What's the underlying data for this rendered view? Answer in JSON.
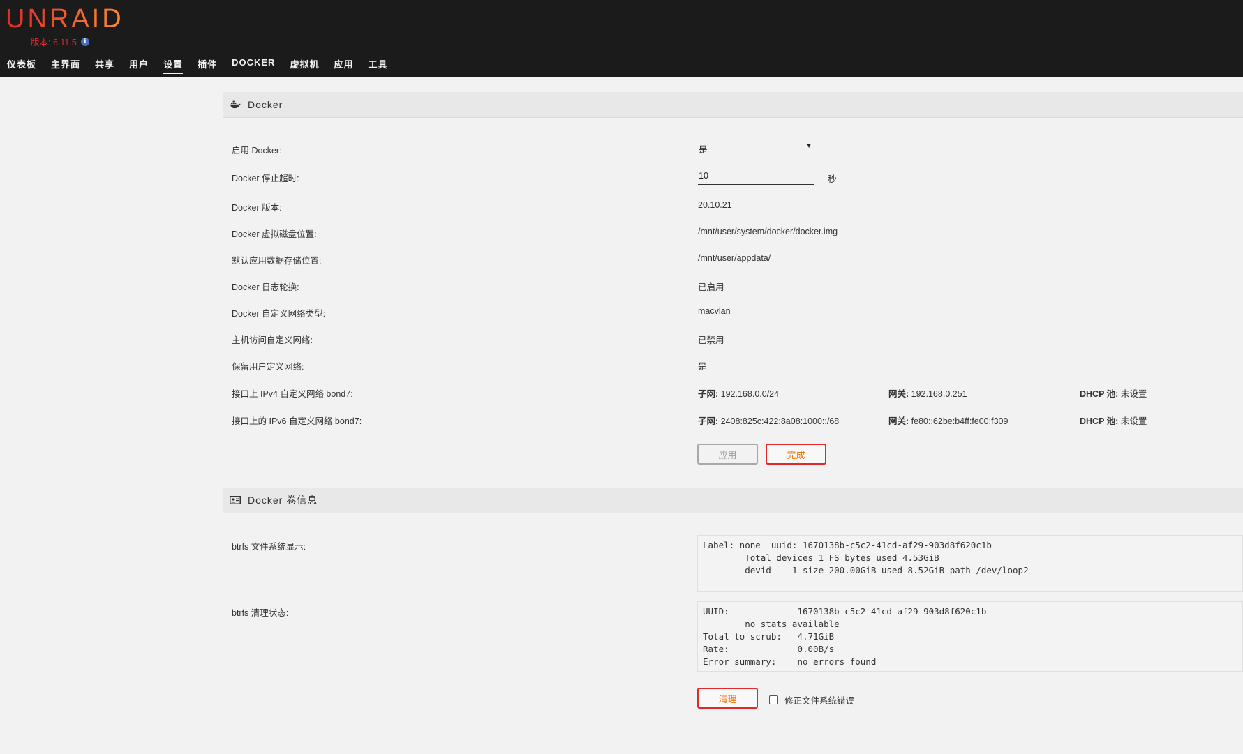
{
  "header": {
    "logo": "UNRAID",
    "version": "版本: 6.11.5",
    "nav": [
      {
        "label": "仪表板"
      },
      {
        "label": "主界面"
      },
      {
        "label": "共享"
      },
      {
        "label": "用户"
      },
      {
        "label": "设置",
        "active": true
      },
      {
        "label": "插件"
      },
      {
        "label": "DOCKER"
      },
      {
        "label": "虚拟机"
      },
      {
        "label": "应用"
      },
      {
        "label": "工具"
      }
    ]
  },
  "docker": {
    "title": "Docker",
    "enable_label": "启用 Docker:",
    "enable_value": "是",
    "timeout_label": "Docker 停止超时:",
    "timeout_value": "10",
    "timeout_unit": "秒",
    "version_label": "Docker 版本:",
    "version_value": "20.10.21",
    "vdisk_label": "Docker 虚拟磁盘位置:",
    "vdisk_value": "/mnt/user/system/docker/docker.img",
    "appdata_label": "默认应用数据存储位置:",
    "appdata_value": "/mnt/user/appdata/",
    "logrotate_label": "Docker 日志轮换:",
    "logrotate_value": "已启用",
    "nettype_label": "Docker 自定义网络类型:",
    "nettype_value": "macvlan",
    "hostaccess_label": "主机访问自定义网络:",
    "hostaccess_value": "已禁用",
    "preserve_label": "保留用户定义网络:",
    "preserve_value": "是",
    "ipv4": {
      "label": "接口上 IPv4 自定义网络 bond7:",
      "subnet_key": "子网:",
      "subnet": "192.168.0.0/24",
      "gateway_key": "网关:",
      "gateway": "192.168.0.251",
      "dhcp_key": "DHCP 池:",
      "dhcp": "未设置"
    },
    "ipv6": {
      "label": "接口上的 IPv6 自定义网络 bond7:",
      "subnet_key": "子网:",
      "subnet": "2408:825c:422:8a08:1000::/68",
      "gateway_key": "网关:",
      "gateway": "fe80::62be:b4ff:fe00:f309",
      "dhcp_key": "DHCP 池:",
      "dhcp": "未设置"
    },
    "apply_button": "应用",
    "done_button": "完成"
  },
  "volume": {
    "title": "Docker 卷信息",
    "btrfs_show_label": "btrfs 文件系统显示:",
    "btrfs_show_text": "Label: none  uuid: 1670138b-c5c2-41cd-af29-903d8f620c1b\n        Total devices 1 FS bytes used 4.53GiB\n        devid    1 size 200.00GiB used 8.52GiB path /dev/loop2",
    "scrub_label": "btrfs 清理状态:",
    "scrub_text": "UUID:             1670138b-c5c2-41cd-af29-903d8f620c1b\n        no stats available\nTotal to scrub:   4.71GiB\nRate:             0.00B/s\nError summary:    no errors found",
    "scrub_button": "清理",
    "fix_errors_label": "修正文件系统错误"
  },
  "colors": {
    "header_bg": "#1c1b1b",
    "accent_red": "#e22828",
    "accent_orange": "#f0760a",
    "page_bg": "#f2f2f2"
  }
}
